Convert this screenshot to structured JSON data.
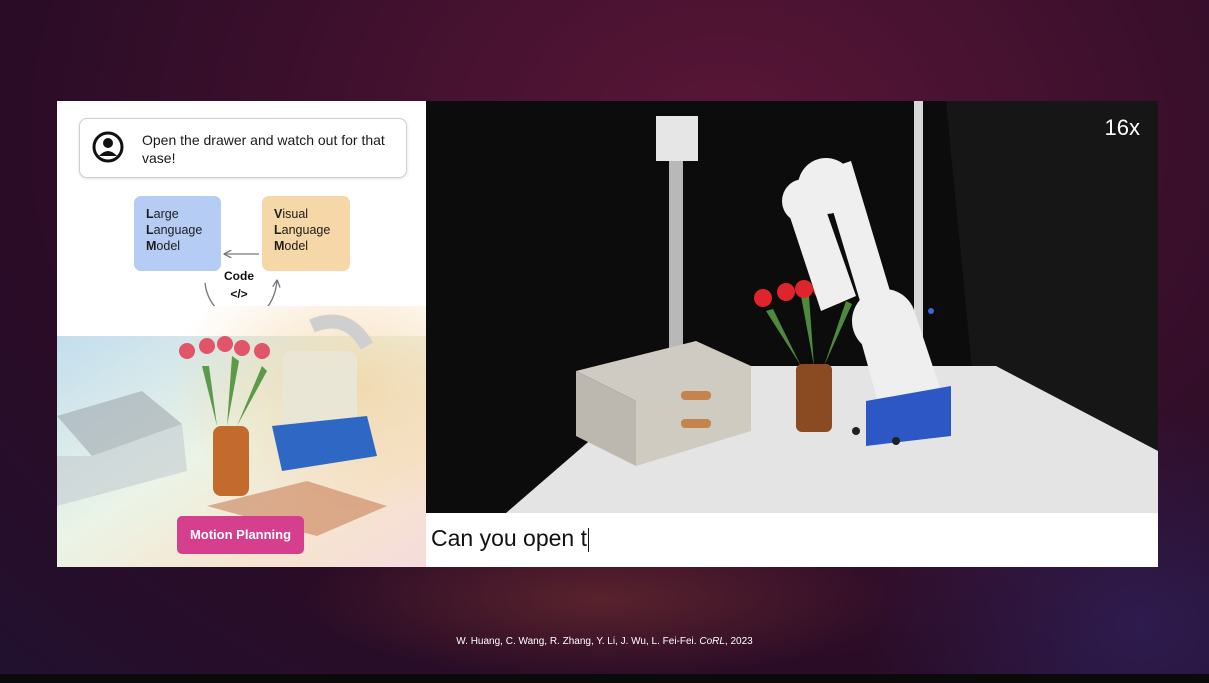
{
  "diagram": {
    "instruction": "Open the drawer and watch out for that vase!",
    "llm_lines": [
      {
        "initial": "L",
        "rest": "arge"
      },
      {
        "initial": "L",
        "rest": "anguage"
      },
      {
        "initial": "M",
        "rest": "odel"
      }
    ],
    "vlm_lines": [
      {
        "initial": "V",
        "rest": "isual"
      },
      {
        "initial": "L",
        "rest": "anguage"
      },
      {
        "initial": "M",
        "rest": "odel"
      }
    ],
    "code_label": "Code\n</>",
    "motion_planning_label": "Motion Planning"
  },
  "video": {
    "speed_label": "16x",
    "caption": "Can you open t"
  },
  "citation": {
    "authors": "W. Huang, C. Wang, R. Zhang, Y. Li, J. Wu, L. Fei-Fei.",
    "venue": "CoRL",
    "year": ", 2023"
  },
  "colors": {
    "llm_box": "#b5cdf4",
    "vlm_box": "#f6d7a7",
    "motion_planning": "#d63e8e",
    "background": "#3a0f2c"
  },
  "icons": [
    "user-icon",
    "arrow-icon"
  ]
}
